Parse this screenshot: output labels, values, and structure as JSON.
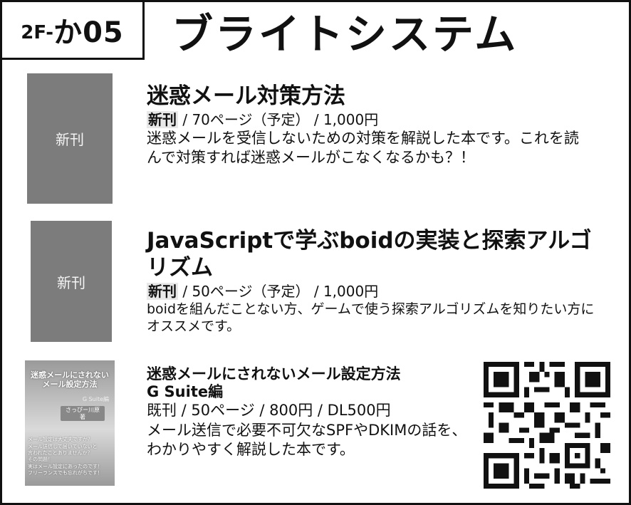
{
  "header": {
    "booth_prefix": "2F-",
    "booth_code": "か05",
    "circle_name": "ブライトシステム"
  },
  "books": [
    {
      "cover_label": "新刊",
      "title": "迷惑メール対策方法",
      "status": "新刊",
      "details": " / 70ページ（予定） / 1,000円",
      "description": "迷惑メールを受信しないための対策を解説した本です。これを読んで対策すれば迷惑メールがこなくなるかも？！"
    },
    {
      "cover_label": "新刊",
      "title": "JavaScriptで学ぶboidの実装と探索アルゴリズム",
      "status": "新刊",
      "details": " / 50ページ（予定） / 1,000円",
      "description": "boidを組んだことない方、ゲームで使う探索アルゴリズムを知りたい方にオススメです。"
    },
    {
      "cover": {
        "title_line1": "迷惑メールにされない",
        "title_line2": "メール設定方法",
        "subtitle": "G Suite編",
        "author": "さっぴー川原　著",
        "blurb": [
          "メール設定は大丈夫ですか？",
          "メール送信して届いていないと",
          "言われたことありませんか？",
          "その問題！",
          "実はメール設定にあったのです！",
          "フリーランスでも忘れがちです！"
        ]
      },
      "title_line1": "迷惑メールにされないメール設定方法",
      "title_line2": "G Suite編",
      "details": "既刊 / 50ページ / 800円 / DL500円",
      "description": "メール送信で必要不可欠なSPFやDKIMの話を、わかりやすく解説した本です。"
    }
  ],
  "qr": {
    "icon": "qr-code-icon"
  }
}
